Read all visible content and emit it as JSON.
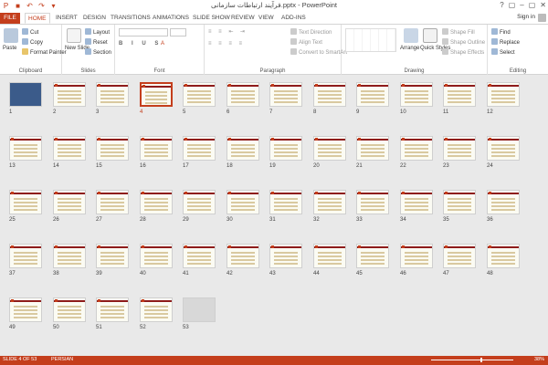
{
  "window": {
    "title": "فرآیند ارتباطات سازمانی.pptx - PowerPoint",
    "controls": [
      "?",
      "▢",
      "–",
      "▢",
      "✕"
    ]
  },
  "tabs": [
    {
      "label": "FILE",
      "kind": "file"
    },
    {
      "label": "HOME",
      "kind": "active"
    },
    {
      "label": "INSERT"
    },
    {
      "label": "DESIGN"
    },
    {
      "label": "TRANSITIONS"
    },
    {
      "label": "ANIMATIONS"
    },
    {
      "label": "SLIDE SHOW"
    },
    {
      "label": "REVIEW"
    },
    {
      "label": "VIEW"
    },
    {
      "label": "ADD-INS"
    }
  ],
  "sign_in": "Sign in",
  "ribbon": {
    "clipboard": {
      "label": "Clipboard",
      "paste": "Paste",
      "cut": "Cut",
      "copy": "Copy",
      "format_painter": "Format Painter"
    },
    "slides": {
      "label": "Slides",
      "new_slide": "New Slide",
      "layout": "Layout",
      "reset": "Reset",
      "section": "Section"
    },
    "font": {
      "label": "Font"
    },
    "paragraph": {
      "label": "Paragraph",
      "text_direction": "Text Direction",
      "align_text": "Align Text",
      "convert_smartart": "Convert to SmartArt"
    },
    "drawing": {
      "label": "Drawing",
      "arrange": "Arrange",
      "quick_styles": "Quick Styles",
      "shape_fill": "Shape Fill",
      "shape_outline": "Shape Outline",
      "shape_effects": "Shape Effects"
    },
    "editing": {
      "label": "Editing",
      "find": "Find",
      "replace": "Replace",
      "select": "Select"
    }
  },
  "slides": {
    "selected": 4,
    "numbers": [
      "1",
      "2",
      "3",
      "4",
      "5",
      "6",
      "7",
      "8",
      "9",
      "10",
      "11",
      "12",
      "13",
      "14",
      "15",
      "16",
      "17",
      "18",
      "19",
      "20",
      "21",
      "22",
      "23",
      "24",
      "25",
      "26",
      "27",
      "28",
      "29",
      "30",
      "31",
      "32",
      "33",
      "34",
      "35",
      "36",
      "37",
      "38",
      "39",
      "40",
      "41",
      "42",
      "43",
      "44",
      "45",
      "46",
      "47",
      "48",
      "49",
      "50",
      "51",
      "52",
      "53"
    ]
  },
  "status": {
    "slide_info": "SLIDE 4 OF 53",
    "language": "PERSIAN",
    "zoom": "38%"
  },
  "colors": {
    "accent": "#c43e1c",
    "slide_bg": "#fbfbf3",
    "slide_stripe": "#8e1b1b"
  }
}
